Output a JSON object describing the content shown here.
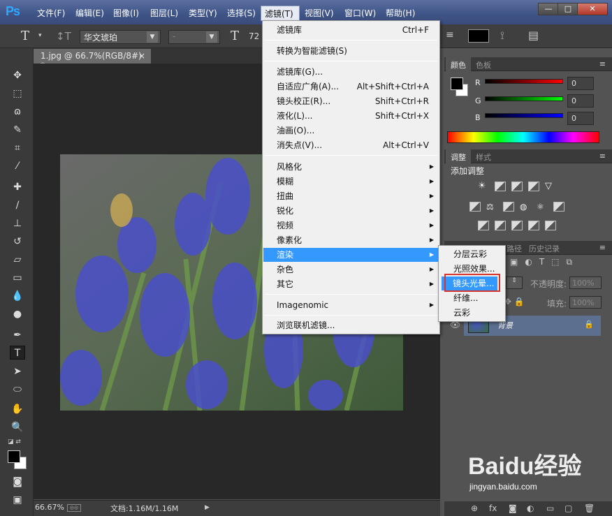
{
  "app": {
    "logo": "Ps"
  },
  "menubar": {
    "items": [
      "文件(F)",
      "编辑(E)",
      "图像(I)",
      "图层(L)",
      "类型(Y)",
      "选择(S)",
      "滤镜(T)",
      "视图(V)",
      "窗口(W)",
      "帮助(H)"
    ]
  },
  "window_controls": {
    "minimize": "—",
    "maximize": "□",
    "close": "✕"
  },
  "options": {
    "font_family": "华文琥珀",
    "font_style": "-",
    "font_size": "72",
    "text_color": "#000000"
  },
  "document": {
    "tab_title": "1.jpg @ 66.7%(RGB/8#) *",
    "tab_close": "×",
    "zoom": "66.67%",
    "doc_info": "文档:1.16M/1.16M"
  },
  "filter_menu": {
    "items": [
      {
        "label": "滤镜库",
        "shortcut": "Ctrl+F"
      },
      {
        "label": "转换为智能滤镜(S)",
        "shortcut": ""
      },
      {
        "label": "滤镜库(G)...",
        "shortcut": ""
      },
      {
        "label": "自适应广角(A)...",
        "shortcut": "Alt+Shift+Ctrl+A"
      },
      {
        "label": "镜头校正(R)...",
        "shortcut": "Shift+Ctrl+R"
      },
      {
        "label": "液化(L)...",
        "shortcut": "Shift+Ctrl+X"
      },
      {
        "label": "油画(O)...",
        "shortcut": ""
      },
      {
        "label": "消失点(V)...",
        "shortcut": "Alt+Ctrl+V"
      },
      {
        "label": "风格化",
        "shortcut": "▶"
      },
      {
        "label": "模糊",
        "shortcut": "▶"
      },
      {
        "label": "扭曲",
        "shortcut": "▶"
      },
      {
        "label": "锐化",
        "shortcut": "▶"
      },
      {
        "label": "视频",
        "shortcut": "▶"
      },
      {
        "label": "像素化",
        "shortcut": "▶"
      },
      {
        "label": "渲染",
        "shortcut": "▶"
      },
      {
        "label": "杂色",
        "shortcut": "▶"
      },
      {
        "label": "其它",
        "shortcut": "▶"
      },
      {
        "label": "Imagenomic",
        "shortcut": "▶"
      },
      {
        "label": "浏览联机滤镜...",
        "shortcut": ""
      }
    ],
    "highlighted": "渲染"
  },
  "render_submenu": {
    "items": [
      "分层云彩",
      "光照效果...",
      "镜头光晕...",
      "纤维...",
      "云彩"
    ],
    "highlighted": "镜头光晕..."
  },
  "color_panel": {
    "tabs": [
      "颜色",
      "色板"
    ],
    "r_label": "R",
    "g_label": "G",
    "b_label": "B",
    "r": "0",
    "g": "0",
    "b": "0"
  },
  "adjust_panel": {
    "tabs": [
      "调整",
      "样式"
    ],
    "heading": "添加调整"
  },
  "layers_panel": {
    "tabs": [
      "路径",
      "历史记录"
    ],
    "opacity_label": "不透明度:",
    "opacity_value": "100%",
    "fill_label": "填充:",
    "fill_value": "100%",
    "layer_name": "背景"
  },
  "watermark": {
    "brand": "Baidu经验",
    "url": "jingyan.baidu.com"
  },
  "colors": {
    "menu_highlight": "#3399ff",
    "annotation_red": "#d9342b",
    "titlebar": "#3e5386"
  }
}
